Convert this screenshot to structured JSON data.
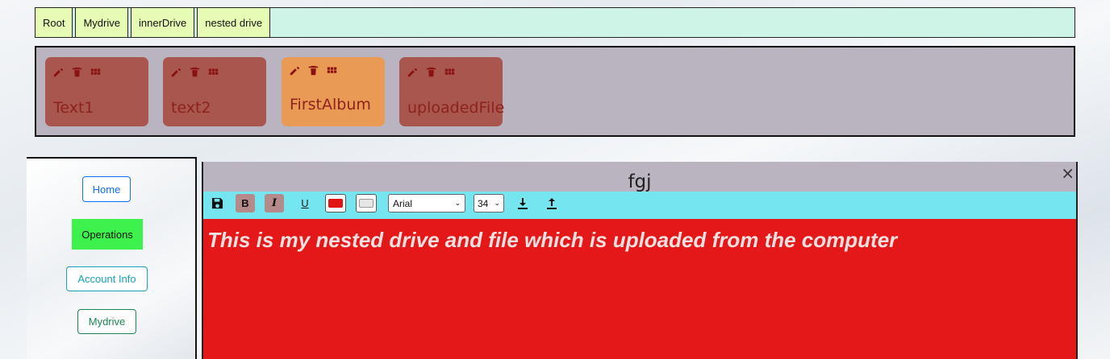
{
  "breadcrumb": {
    "items": [
      "Root",
      "Mydrive",
      "innerDrive",
      "nested drive"
    ]
  },
  "items": [
    {
      "label": "Text1",
      "active": false
    },
    {
      "label": "text2",
      "active": false
    },
    {
      "label": "FirstAlbum",
      "active": true
    },
    {
      "label": "uploadedFile",
      "active": false
    }
  ],
  "sidebar": {
    "home": "Home",
    "operations": "Operations",
    "account_info": "Account Info",
    "mydrive": "Mydrive"
  },
  "editor": {
    "title": "fgj",
    "close": "×",
    "toolbar": {
      "save_icon": "save-icon",
      "bold": "B",
      "italic": "I",
      "underline": "U",
      "font_color": "#e01414",
      "background_color": "#e6e6e6",
      "font_family": "Arial",
      "font_size": "34",
      "download_icon": "download-icon",
      "upload_icon": "upload-icon"
    },
    "content": "This is my nested drive and file which is uploaded from the computer",
    "content_background": "#e41818"
  },
  "colors": {
    "breadcrumb_bg": "#cdf4e6",
    "crumb_bg": "#e6fbb4",
    "item_bg": "#a8564e",
    "item_active_bg": "#e99a55",
    "toolbar_bg": "#75e5f0",
    "operations_bg": "#3ef24e"
  }
}
